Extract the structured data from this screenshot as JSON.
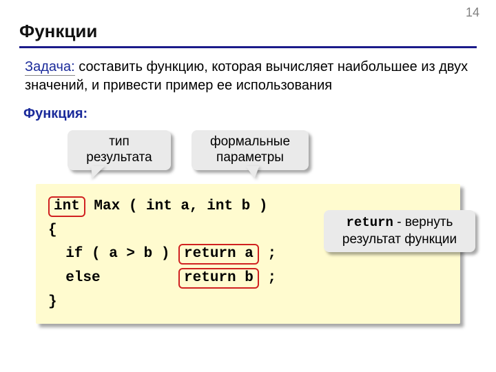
{
  "page_number": "14",
  "title": "Функции",
  "task": {
    "label": "Задача:",
    "text": " составить функцию, которая вычисляет наибольшее из двух значений, и привести пример ее использования"
  },
  "function_label": "Функция:",
  "callouts": {
    "result_type": "тип результата",
    "formal_params": "формальные параметры",
    "return_kw": "return",
    "return_text": " - вернуть результат функции"
  },
  "code": {
    "int": "int",
    "sig_rest": " Max ( int a, int b )",
    "brace_open": "{",
    "if_part": "  if ( a > b ) ",
    "return_a": "return a",
    "semi": " ;",
    "else_part": "  else         ",
    "return_b": "return b",
    "brace_close": "}"
  }
}
